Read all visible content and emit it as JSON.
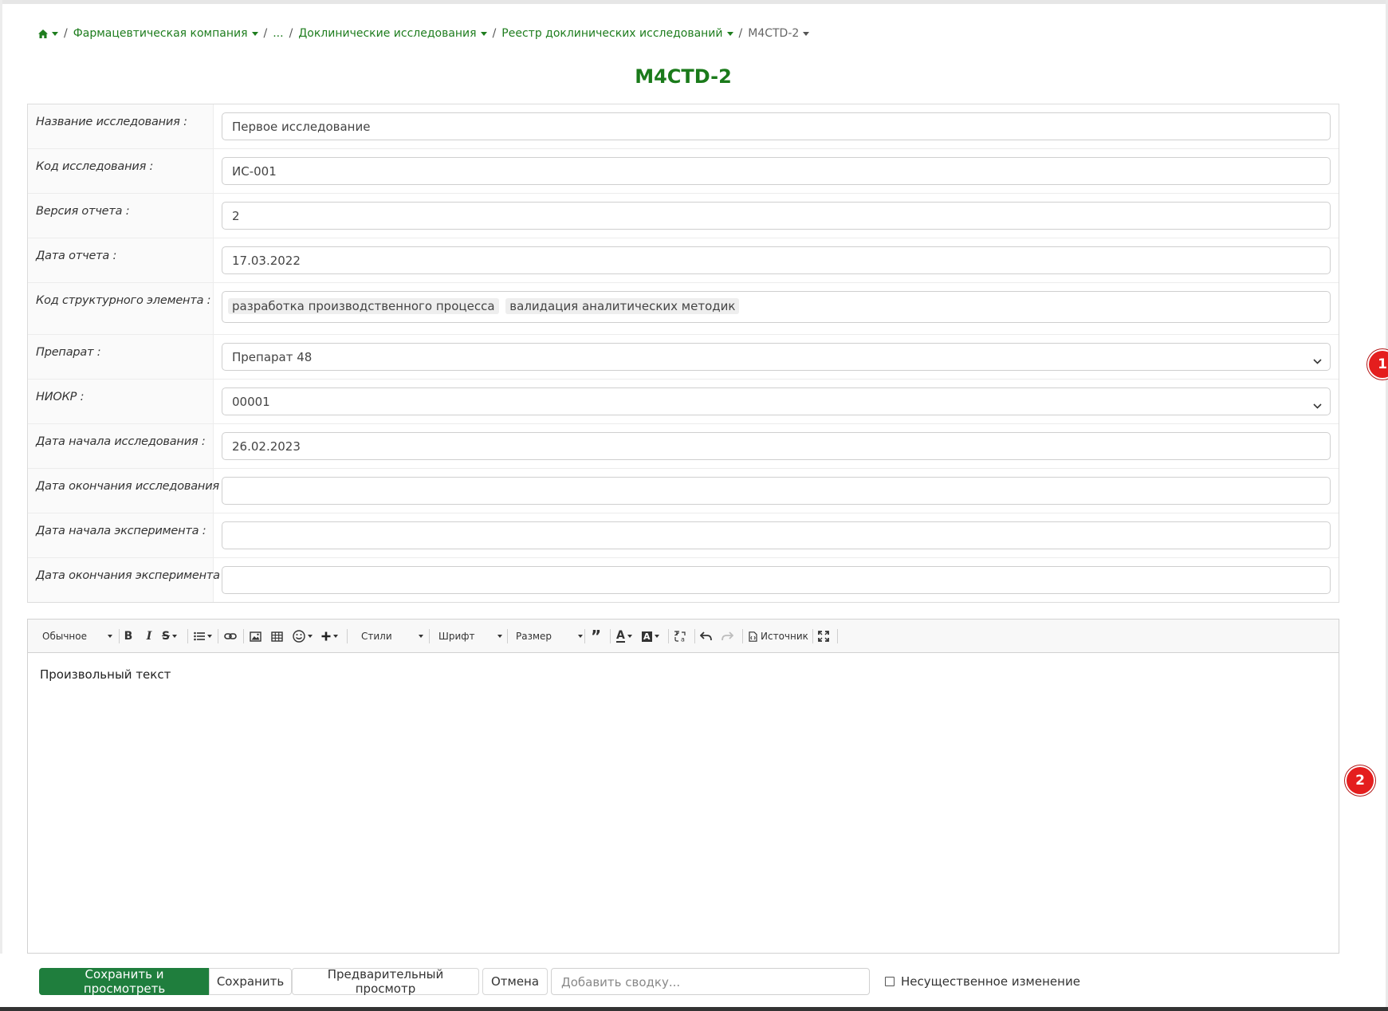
{
  "breadcrumb": {
    "items": [
      {
        "label": "Фармацевтическая компания"
      },
      {
        "label": "..."
      },
      {
        "label": "Доклинические исследования"
      },
      {
        "label": "Реестр доклинических исследований"
      }
    ],
    "current": "M4CTD-2"
  },
  "page": {
    "title": "M4CTD-2"
  },
  "form": {
    "rows": [
      {
        "label": "Название исследования :",
        "value": "Первое исследование"
      },
      {
        "label": "Код исследования :",
        "value": "ИС-001"
      },
      {
        "label": "Версия отчета :",
        "value": "2"
      },
      {
        "label": "Дата отчета :",
        "value": "17.03.2022"
      },
      {
        "label": "Код структурного элемента :",
        "tags": [
          "разработка производственного процесса",
          "валидация аналитических методик"
        ]
      },
      {
        "label": "Препарат :",
        "value": "Препарат 48"
      },
      {
        "label": "НИОКР :",
        "value": "00001"
      },
      {
        "label": "Дата начала исследования :",
        "value": "26.02.2023"
      },
      {
        "label": "Дата окончания исследования :",
        "value": ""
      },
      {
        "label": "Дата начала эксперимента :",
        "value": ""
      },
      {
        "label": "Дата окончания эксперимента :",
        "value": ""
      }
    ]
  },
  "editor": {
    "toolbar": {
      "format": "Обычное",
      "styles": "Стили",
      "font": "Шрифт",
      "size": "Размер",
      "source": "Источник"
    },
    "content": "Произвольный текст"
  },
  "markers": [
    "1",
    "2"
  ],
  "actions": {
    "save_view": "Сохранить и просмотреть",
    "save": "Сохранить",
    "preview": "Предварительный просмотр",
    "cancel": "Отмена",
    "summary_placeholder": "Добавить сводку...",
    "minor_change": "Несущественное изменение"
  },
  "colors": {
    "accent": "#1f7e3d",
    "link": "#1e7d1e",
    "marker": "#e41e1e"
  }
}
